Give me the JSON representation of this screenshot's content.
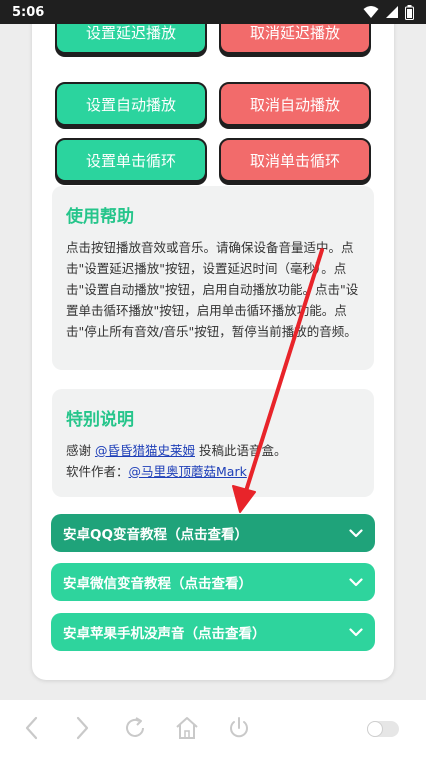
{
  "status": {
    "time": "5:06"
  },
  "buttons": {
    "set_delay": "设置延迟播放",
    "cancel_delay": "取消延迟播放",
    "set_auto": "设置自动播放",
    "cancel_auto": "取消自动播放",
    "set_loop": "设置单击循环",
    "cancel_loop": "取消单击循环"
  },
  "help": {
    "title": "使用帮助",
    "body": "点击按钮播放音效或音乐。请确保设备音量适中。点击\"设置延迟播放\"按钮，设置延迟时间（毫秒）。点击\"设置自动播放\"按钮，启用自动播放功能。点击\"设置单击循环播放\"按钮，启用单击循环播放功能。点击\"停止所有音效/音乐\"按钮，暂停当前播放的音频。"
  },
  "special": {
    "title": "特别说明",
    "thanks_prefix": "感谢 ",
    "thanks_link": "@昏昏猎猫史莱姆",
    "thanks_suffix": " 投稿此语音盒。",
    "author_prefix": "软件作者：",
    "author_link": "@马里奥顶蘑菇Mark"
  },
  "accordions": [
    {
      "label": "安卓QQ变音教程（点击查看）"
    },
    {
      "label": "安卓微信变音教程（点击查看）"
    },
    {
      "label": "安卓苹果手机没声音（点击查看）"
    }
  ],
  "colors": {
    "accent_green": "#2bd49e",
    "accent_red": "#f26b6b",
    "title_green": "#26c58b",
    "link_blue": "#1e3fb8",
    "arrow_red": "#e8242a"
  }
}
